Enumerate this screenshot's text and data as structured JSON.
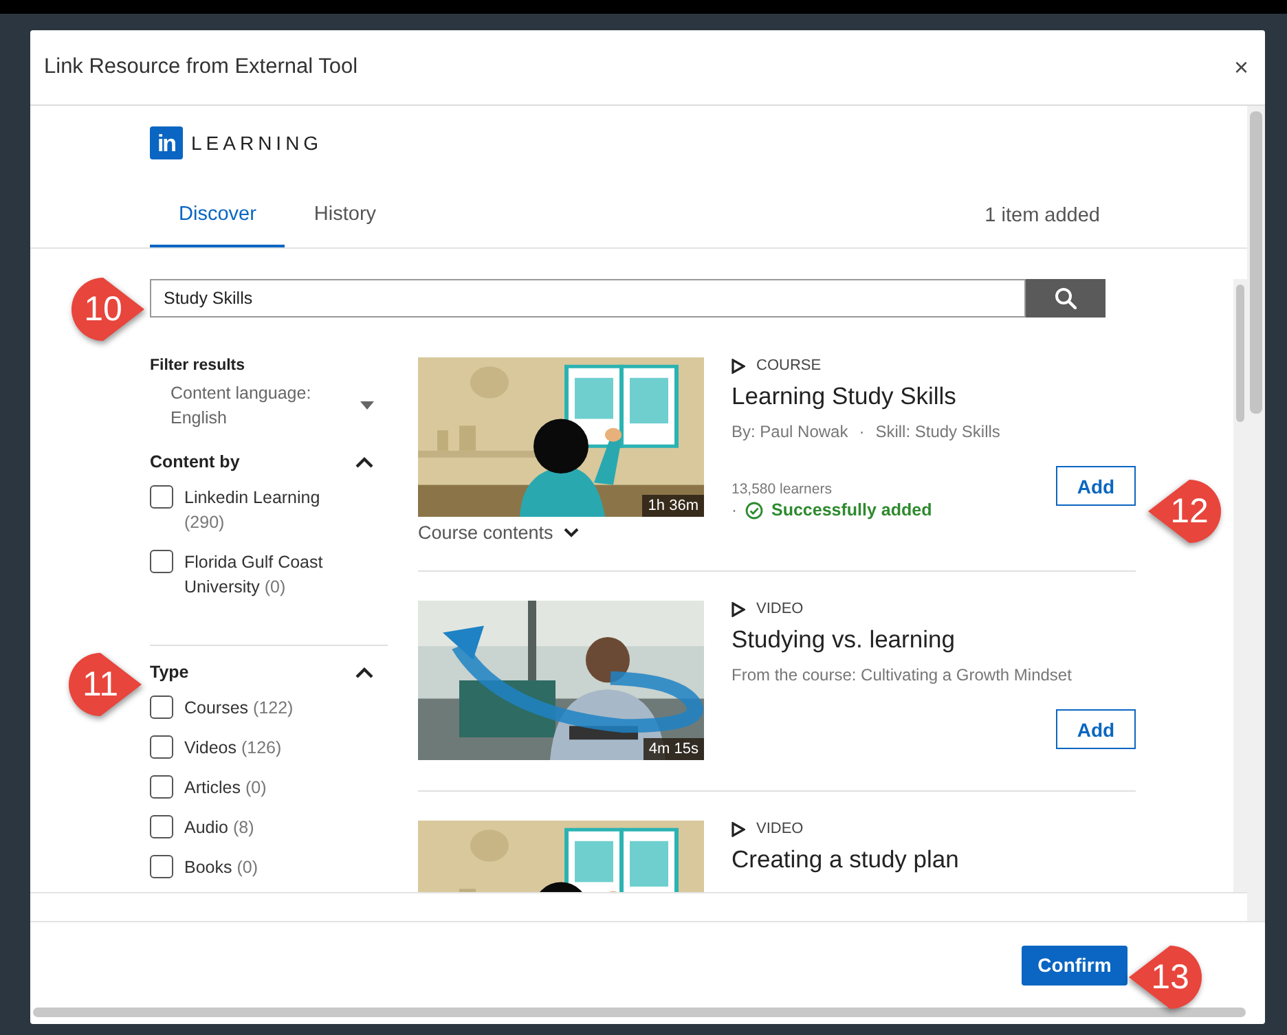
{
  "window": {
    "title": "Link Resource from External Tool",
    "close": "×"
  },
  "logo": {
    "mark": "in",
    "text": "LEARNING"
  },
  "tabs": [
    {
      "label": "Discover",
      "selected": true
    },
    {
      "label": "History",
      "selected": false
    }
  ],
  "added_count": "1 item added",
  "search": {
    "value": "Study Skills"
  },
  "filters": {
    "title": "Filter results",
    "language": {
      "label": "Content language:",
      "value": "English"
    },
    "groups": [
      {
        "title": "Content by",
        "expanded": true,
        "options": [
          {
            "label": "Linkedin Learning",
            "count": "(290)",
            "checked": false
          },
          {
            "label": "Florida Gulf Coast University",
            "count": "(0)",
            "checked": false
          }
        ]
      },
      {
        "title": "Type",
        "expanded": true,
        "options": [
          {
            "label": "Courses",
            "count": "(122)",
            "checked": false
          },
          {
            "label": "Videos",
            "count": "(126)",
            "checked": false
          },
          {
            "label": "Articles",
            "count": "(0)",
            "checked": false
          },
          {
            "label": "Audio",
            "count": "(8)",
            "checked": false
          },
          {
            "label": "Books",
            "count": "(0)",
            "checked": false
          }
        ]
      }
    ]
  },
  "results": [
    {
      "type": "COURSE",
      "title": "Learning Study Skills",
      "meta": [
        "By: Paul Nowak",
        "Skill: Study Skills"
      ],
      "meta_separator": "·",
      "status_separator": "·",
      "learners": "13,580 learners",
      "status": "Successfully added",
      "duration": "1h 36m",
      "contents_link": "Course contents",
      "button": "Add"
    },
    {
      "type": "VIDEO",
      "title": "Studying vs. learning",
      "meta": [
        "From the course: Cultivating a Growth Mindset"
      ],
      "duration": "4m 15s",
      "button": "Add"
    },
    {
      "type": "VIDEO",
      "title": "Creating a study plan"
    }
  ],
  "confirm": "Confirm",
  "callouts": [
    {
      "number": "10"
    },
    {
      "number": "11"
    },
    {
      "number": "12"
    },
    {
      "number": "13"
    }
  ]
}
